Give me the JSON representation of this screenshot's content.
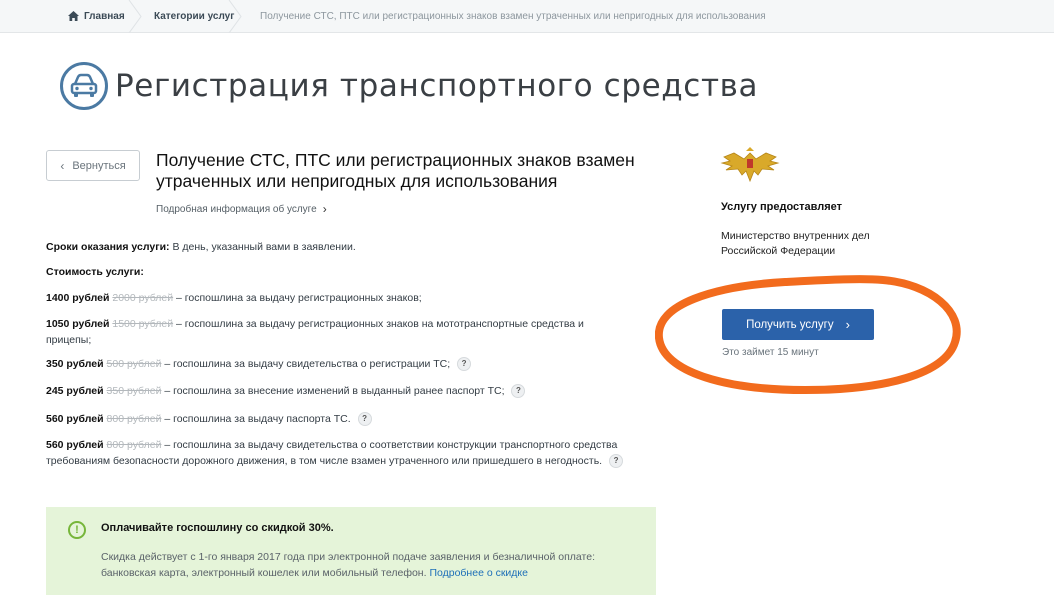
{
  "breadcrumb": {
    "home": "Главная",
    "category": "Категории услуг",
    "current": "Получение СТС, ПТС или регистрационных знаков взамен утраченных или непригодных для использования"
  },
  "page": {
    "title": "Регистрация транспортного средства",
    "back_label": "Вернуться",
    "service_title": "Получение СТС, ПТС или регистрационных знаков взамен утраченных или непригодных для использования",
    "more_info": "Подробная информация об услуге"
  },
  "terms": {
    "label": "Сроки оказания услуги:",
    "value": " В день, указанный вами в заявлении."
  },
  "cost": {
    "label": "Стоимость услуги:",
    "items": [
      {
        "price": "1400 рублей",
        "old": "2000 рублей",
        "desc": " – госпошлина за выдачу регистрационных знаков;"
      },
      {
        "price": "1050 рублей",
        "old": "1500 рублей",
        "desc": " – госпошлина за выдачу регистрационных знаков на мототранспортные средства и",
        "desc2": "прицепы;"
      },
      {
        "price": "350 рублей",
        "old": "500 рублей",
        "desc": " – госпошлина за выдачу свидетельства о регистрации ТС;"
      },
      {
        "price": "245 рублей",
        "old": "350 рублей",
        "desc": " – госпошлина за внесение изменений в выданный ранее паспорт ТС;"
      },
      {
        "price": "560 рублей",
        "old": "800 рублей",
        "desc": " – госпошлина за выдачу паспорта ТС."
      },
      {
        "price": "560 рублей",
        "old": "800 рублей",
        "desc": " – госпошлина за выдачу свидетельства о соответствии конструкции транспортного средства",
        "desc2": "требованиям безопасности дорожного движения, в том числе взамен утраченного или пришедшего в негодность."
      }
    ],
    "help_mark": "?"
  },
  "discount": {
    "icon": "!",
    "title": "Оплачивайте госпошлину со скидкой 30%.",
    "text_line1": "Скидка действует с 1-го января 2017 года при электронной подаче заявления и безналичной оплате:",
    "text_line2": "банковская карта, электронный кошелек или мобильный телефон. ",
    "link": "Подробнее о скидке"
  },
  "provider": {
    "label": "Услугу предоставляет",
    "name": "Министерство внутренних дел Российской Федерации"
  },
  "action": {
    "button": "Получить услугу",
    "duration": "Это займет 15 минут"
  },
  "colors": {
    "accent": "#2b62aa",
    "annotation": "#f26b1d",
    "discount_bg": "#e5f4d9"
  }
}
